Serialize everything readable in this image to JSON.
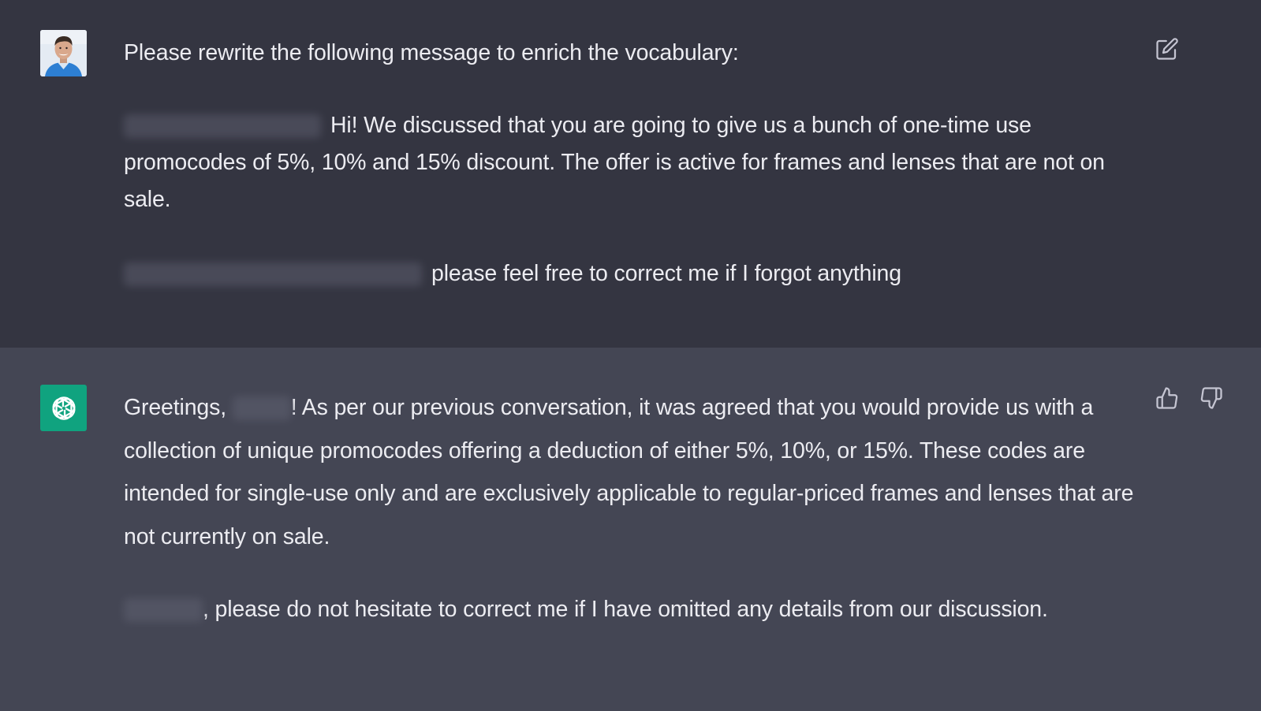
{
  "user_message": {
    "avatar_icon": "user-photo-avatar",
    "edit_icon": "edit-icon",
    "prompt": "Please rewrite the following message to enrich the vocabulary:",
    "paragraph_1": "Hi! We discussed that you are going to give us a bunch of one-time use promocodes of 5%, 10% and 15% discount. The offer is active for frames and lenses that are not on sale.",
    "paragraph_2": "please feel free to correct me if I forgot anything"
  },
  "assistant_message": {
    "avatar_icon": "openai-logo-icon",
    "thumbs_up_icon": "thumbs-up-icon",
    "thumbs_down_icon": "thumbs-down-icon",
    "greeting": "Greetings,",
    "paragraph_1_rest": "! As per our previous conversation, it was agreed that you would provide us with a collection of unique promocodes offering a deduction of either 5%, 10%, or 15%. These codes are intended for single-use only and are exclusively applicable to regular-priced frames and lenses that are not currently on sale.",
    "paragraph_2_rest": ", please do not hesitate to correct me if I have omitted any details from our discussion."
  },
  "colors": {
    "user_bg": "#343541",
    "assistant_bg": "#444654",
    "text": "#ececf1",
    "icon": "#c5c5d2",
    "openai_green": "#10a37f"
  }
}
